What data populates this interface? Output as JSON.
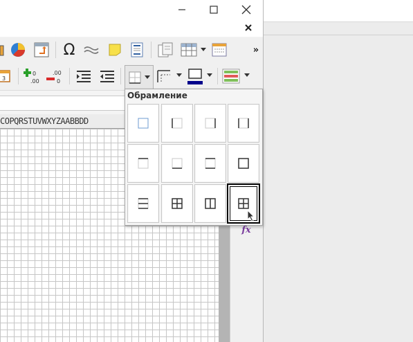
{
  "window": {
    "controls": {
      "minimize": "minimize",
      "maximize": "maximize",
      "close": "close"
    }
  },
  "toolbar1": {
    "items": [
      "image-icon",
      "chart-icon",
      "pivot-table-icon",
      "special-character-icon",
      "hyperlink-icon",
      "comment-icon",
      "header-footer-icon",
      "print-range-icon",
      "freeze-rows-icon",
      "show-draw-functions-icon"
    ],
    "overflow": "»"
  },
  "toolbar2": {
    "add_decimal_label": ".0\n.00",
    "delete_decimal_label": ".00\n.0",
    "items": [
      "calendar-icon",
      "add-decimal-icon",
      "delete-decimal-icon",
      "increase-indent-icon",
      "decrease-indent-icon",
      "borders-icon",
      "border-style-icon",
      "border-color-icon",
      "conditional-format-icon"
    ],
    "border_color": "#00008b"
  },
  "column_headers": "COPQRSTUVWXYZAABBDD",
  "sidebar": {
    "functions_icon": "fx"
  },
  "borders_popup": {
    "title": "Обрамление",
    "options": [
      "no-borders",
      "left-border",
      "right-border",
      "left-right-borders",
      "top-border",
      "bottom-border",
      "top-bottom-borders",
      "outer-border",
      "horizontal-inner-borders",
      "outer-and-inner-borders",
      "outer-and-vertical-borders",
      "all-borders"
    ],
    "selected_index": 11
  },
  "colors": {
    "accent": "#6c9bd2",
    "fx": "#7b3f9e"
  }
}
